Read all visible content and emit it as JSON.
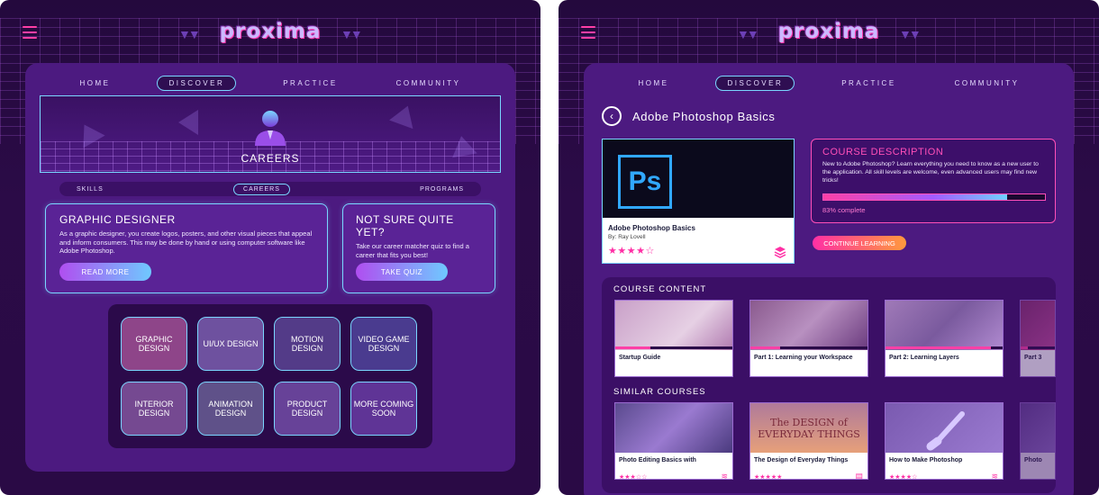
{
  "app": {
    "logo": "proxima"
  },
  "nav": {
    "home": "HOME",
    "discover": "DISCOVER",
    "practice": "PRACTICE",
    "community": "COMMUNITY"
  },
  "left": {
    "banner_title": "CAREERS",
    "subnav": {
      "skills": "SKILLS",
      "careers": "CAREERS",
      "programs": "PROGRAMS"
    },
    "designer_card": {
      "title": "GRAPHIC DESIGNER",
      "text": "As a graphic designer, you create logos, posters, and other visual pieces that appeal and inform consumers. This may be done by hand or using computer software like Adobe Photoshop.",
      "button": "READ MORE"
    },
    "quiz_card": {
      "title": "NOT SURE QUITE YET?",
      "text": "Take our career matcher quiz to find a career that fits you best!",
      "button": "TAKE QUIZ"
    },
    "tiles": [
      {
        "label": "GRAPHIC DESIGN",
        "color": "#c0506e"
      },
      {
        "label": "UI/UX DESIGN",
        "color": "#7a6a9e"
      },
      {
        "label": "MOTION DESIGN",
        "color": "#3e3a6a"
      },
      {
        "label": "VIDEO GAME DESIGN",
        "color": "#2c3b7a"
      },
      {
        "label": "INTERIOR DESIGN",
        "color": "#8a5a7e"
      },
      {
        "label": "ANIMATION DESIGN",
        "color": "#5a6a6e"
      },
      {
        "label": "PRODUCT DESIGN",
        "color": "#6a4a8e"
      },
      {
        "label": "MORE COMING SOON",
        "color": "#5a2a8a"
      }
    ]
  },
  "right": {
    "course_title": "Adobe Photoshop Basics",
    "card": {
      "logo": "Ps",
      "name": "Adobe Photoshop Basics",
      "author": "By: Ray Lovell",
      "stars": "★★★★☆",
      "rating": 4.5,
      "icon": "layers-icon"
    },
    "description": {
      "title": "COURSE DESCRIPTION",
      "text": "New to Adobe Photoshop? Learn everything you need to know as a new user to the application. All skill levels are welcome, even advanced users may find new tricks!",
      "progress": 0.83,
      "progress_label": "83% complete"
    },
    "continue_button": "CONTINUE LEARNING",
    "course_content_title": "COURSE CONTENT",
    "course_content": [
      {
        "title": "Startup Guide",
        "progress": 0.3,
        "color": "#c9a0c8"
      },
      {
        "title": "Part 1: Learning your Workspace",
        "progress": 0.25,
        "color": "#8a5a8e"
      },
      {
        "title": "Part 2: Learning Layers",
        "progress": 0.9,
        "color": "#a07ab8"
      },
      {
        "title": "Part 3",
        "progress": 0.2,
        "color": "#8a3070"
      }
    ],
    "similar_title": "SIMILAR COURSES",
    "similar_courses": [
      {
        "title": "Photo Editing Basics with",
        "stars": "★★★☆☆",
        "icon": "layers-icon",
        "color": "#5a4a8e"
      },
      {
        "title": "The Design of Everyday Things",
        "stars": "★★★★★",
        "icon": "book-icon",
        "color": "#d48a7a"
      },
      {
        "title": "How to Make Photoshop",
        "stars": "★★★★☆",
        "icon": "layers-icon",
        "color": "#7a5ab0"
      },
      {
        "title": "Photo",
        "stars": "",
        "icon": "",
        "color": "#6a4a9e"
      }
    ],
    "book_cover_text": "The DESIGN of EVERYDAY THINGS"
  },
  "colors": {
    "accent_pink": "#ff3fa6",
    "accent_cyan": "#7ad6ff",
    "panel": "#4c1a80"
  }
}
